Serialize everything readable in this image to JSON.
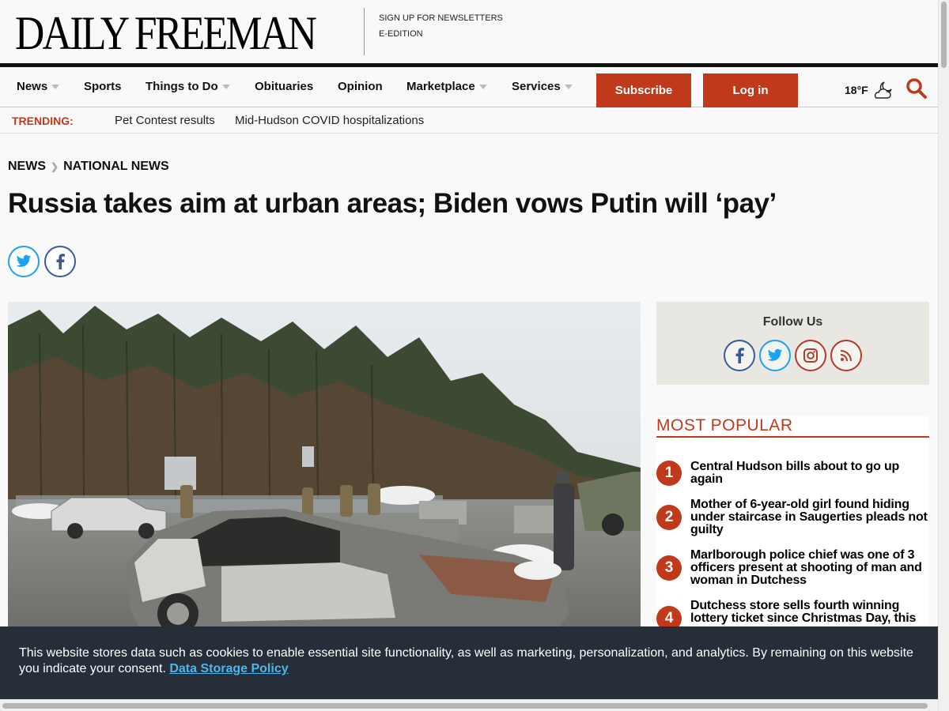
{
  "masthead": {
    "logo": "DAILY FREEMAN",
    "links": [
      "SIGN UP FOR NEWSLETTERS",
      "E-EDITION"
    ]
  },
  "nav": {
    "items": [
      {
        "label": "News",
        "dropdown": true
      },
      {
        "label": "Sports",
        "dropdown": false
      },
      {
        "label": "Things to Do",
        "dropdown": true
      },
      {
        "label": "Obituaries",
        "dropdown": false
      },
      {
        "label": "Opinion",
        "dropdown": false
      },
      {
        "label": "Marketplace",
        "dropdown": true
      },
      {
        "label": "Services",
        "dropdown": true
      }
    ],
    "subscribe_label": "Subscribe",
    "login_label": "Log in",
    "temperature": "18°F",
    "weather_icon": "partly-cloudy-night-icon",
    "search_icon": "search-icon"
  },
  "trending": {
    "label": "TRENDING:",
    "links": [
      "Pet Contest results",
      "Mid-Hudson COVID hospitalizations"
    ]
  },
  "article": {
    "breadcrumb": [
      "NEWS",
      "NATIONAL NEWS"
    ],
    "headline": "Russia takes aim at urban areas; Biden vows Putin will ‘pay’",
    "share_icons": [
      "twitter-icon",
      "facebook-icon"
    ]
  },
  "sidebar": {
    "follow_title": "Follow Us",
    "social_icons": [
      "facebook-icon",
      "twitter-icon",
      "instagram-icon",
      "rss-icon"
    ],
    "most_popular_title": "MOST POPULAR",
    "most_popular": [
      {
        "rank": "1",
        "title": "Central Hudson bills about to go up again"
      },
      {
        "rank": "2",
        "title": "Mother of 6-year-old girl found hiding under staircase in Saugerties pleads not guilty"
      },
      {
        "rank": "3",
        "title": "Marlborough police chief was one of 3 officers present at shooting of man and woman in Dutchess"
      },
      {
        "rank": "4",
        "title": "Dutchess store sells fourth winning lottery ticket since Christmas Day, this"
      }
    ]
  },
  "cookie": {
    "text": "This website stores data such as cookies to enable essential site functionality, as well as marketing, personalization, and analytics. By remaining on this website you indicate your consent.",
    "link_label": "Data Storage Policy"
  },
  "colors": {
    "accent": "#c0391b",
    "cookie_bg": "#262e3a",
    "cookie_link": "#4fb6ec",
    "twitter": "#1da1f2",
    "facebook": "#3b5998"
  }
}
